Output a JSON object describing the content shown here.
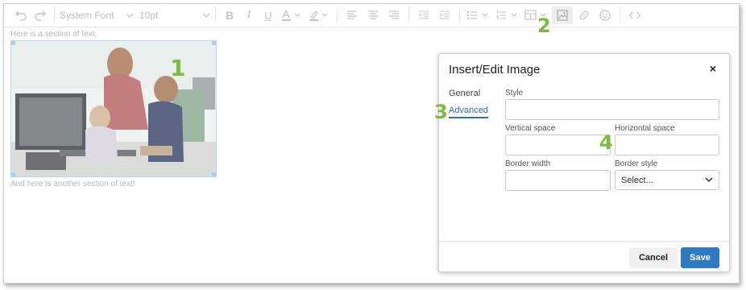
{
  "toolbar": {
    "font_family": "System Font",
    "font_size": "10pt",
    "annotation": "2"
  },
  "editor": {
    "text_before_image": "Here is a section of text.",
    "text_after_image": "And here is another section of text!",
    "image_annotation": "1"
  },
  "dialog": {
    "title": "Insert/Edit Image",
    "close_symbol": "×",
    "tabs": [
      {
        "label": "General"
      },
      {
        "label": "Advanced"
      }
    ],
    "tab_annotation": "3",
    "fields_annotation": "4",
    "fields": {
      "style_label": "Style",
      "vertical_space_label": "Vertical space",
      "horizontal_space_label": "Horizontal space",
      "border_width_label": "Border width",
      "border_style_label": "Border style",
      "border_style_value": "Select..."
    },
    "buttons": {
      "cancel": "Cancel",
      "save": "Save"
    }
  },
  "colors": {
    "accent": "#2e7abf",
    "annotation": "#7dbb3c",
    "selection": "#a9cff5"
  }
}
